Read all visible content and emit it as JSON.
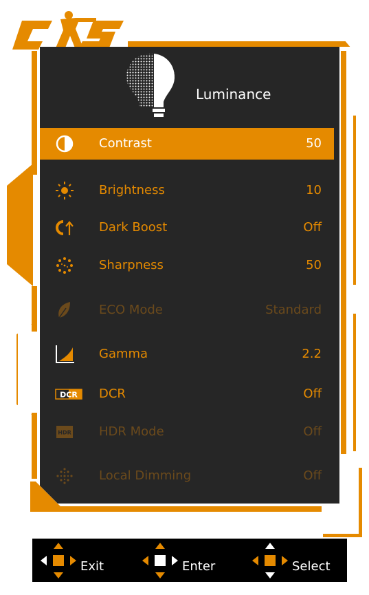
{
  "brand": {
    "logo_text": "CS",
    "accent_color": "#E58A00",
    "disabled_color": "#6B4A1C",
    "panel_color": "#262626"
  },
  "menu": {
    "title": "Luminance",
    "title_icon": "bulb-icon",
    "items": [
      {
        "label": "Contrast",
        "value": "50",
        "icon": "contrast-icon",
        "state": "selected"
      },
      {
        "label": "Brightness",
        "value": "10",
        "icon": "brightness-icon",
        "state": "normal"
      },
      {
        "label": "Dark Boost",
        "value": "Off",
        "icon": "dark-boost-icon",
        "state": "normal"
      },
      {
        "label": "Sharpness",
        "value": "50",
        "icon": "sharpness-icon",
        "state": "normal"
      },
      {
        "label": "ECO Mode",
        "value": "Standard",
        "icon": "leaf-icon",
        "state": "disabled"
      },
      {
        "label": "Gamma",
        "value": "2.2",
        "icon": "gamma-icon",
        "state": "normal"
      },
      {
        "label": "DCR",
        "value": "Off",
        "icon": "dcr-icon",
        "icon_text": "DCR",
        "state": "normal"
      },
      {
        "label": "HDR Mode",
        "value": "Off",
        "icon": "hdr-icon",
        "icon_text": "HDR",
        "state": "disabled"
      },
      {
        "label": "Local Dimming",
        "value": "Off",
        "icon": "local-dimming-icon",
        "state": "disabled"
      }
    ]
  },
  "navbar": {
    "exit_label": "Exit",
    "enter_label": "Enter",
    "select_label": "Select"
  }
}
